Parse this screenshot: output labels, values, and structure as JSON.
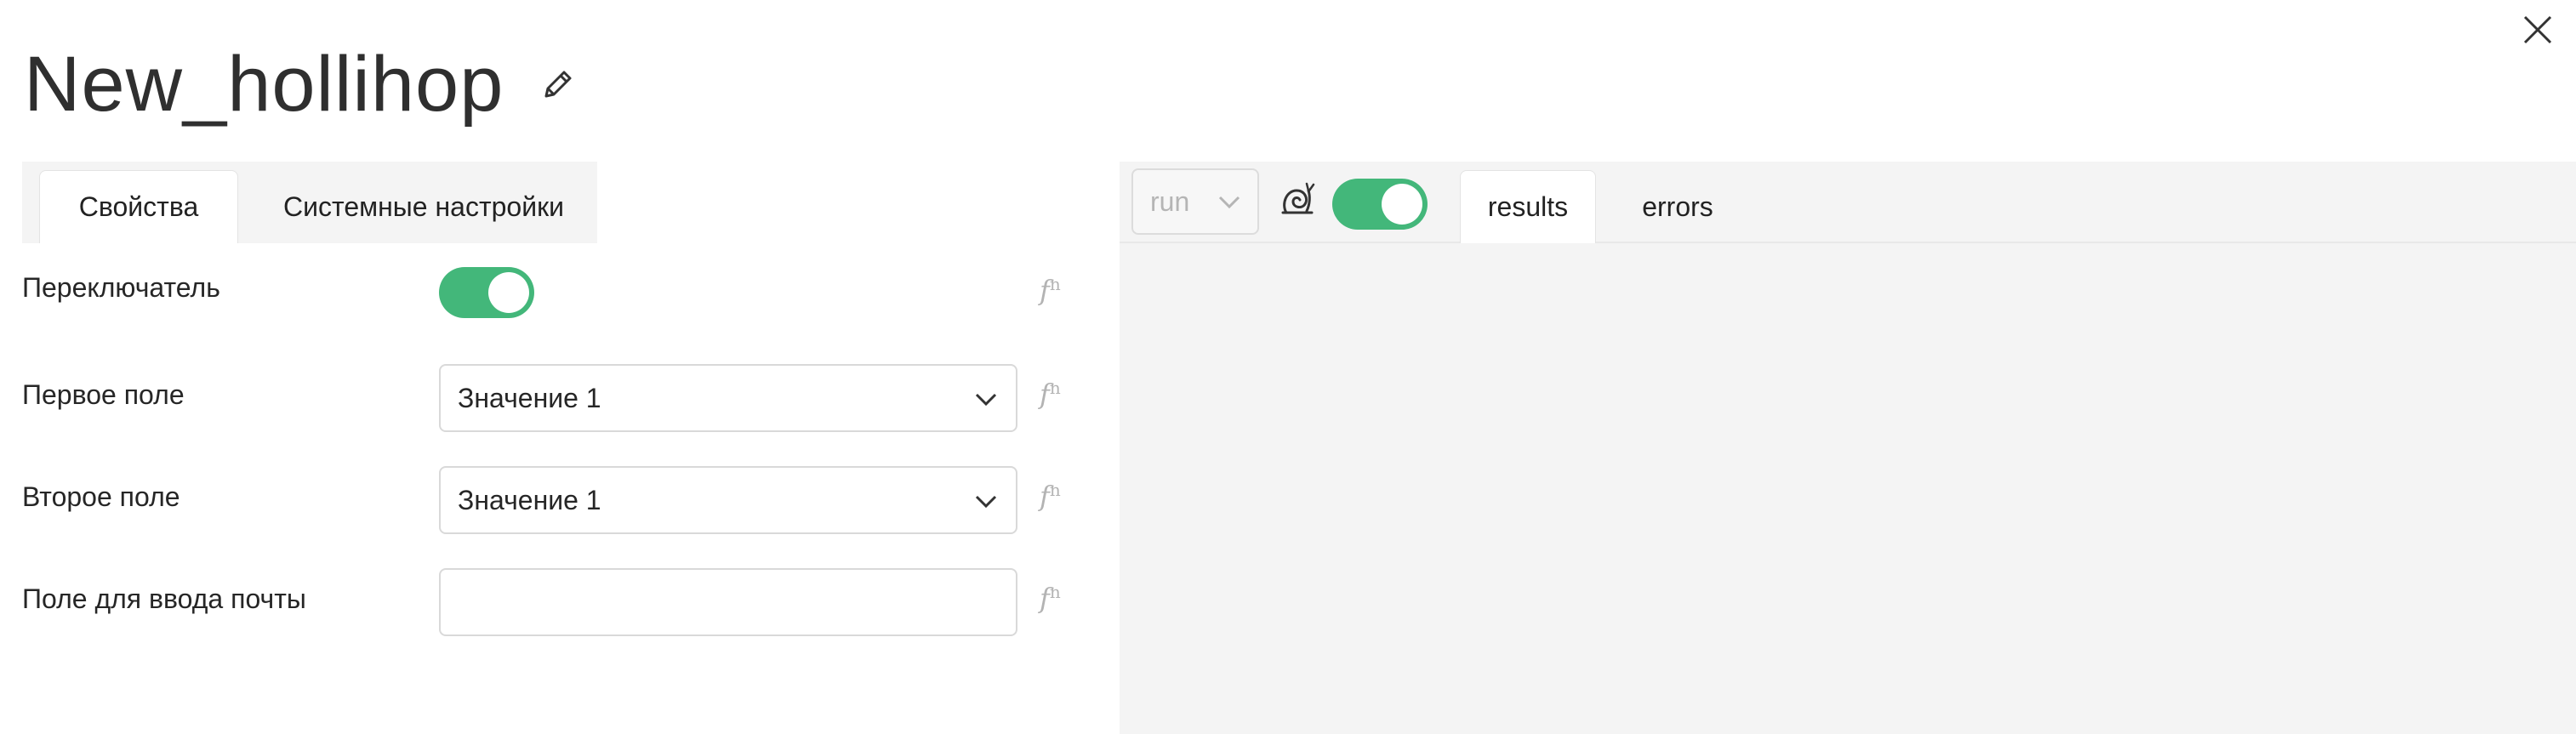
{
  "page": {
    "title": "New_hollihop"
  },
  "icons": {
    "close": "close-icon",
    "edit": "pencil-icon",
    "fn": "function-icon",
    "chevron": "chevron-down-icon",
    "snail": "snail-icon"
  },
  "colors": {
    "accent": "#43b77a",
    "panel_bg": "#f4f4f4",
    "muted": "#b3b3b3"
  },
  "left_tabs": [
    {
      "label": "Свойства",
      "active": true
    },
    {
      "label": "Системные настройки",
      "active": false
    }
  ],
  "fields": {
    "switch": {
      "label": "Переключатель",
      "fn": "f",
      "fn_sup": "n",
      "value": true
    },
    "first": {
      "label": "Первое поле",
      "value": "Значение 1",
      "fn": "f",
      "fn_sup": "n"
    },
    "second": {
      "label": "Второе поле",
      "value": "Значение 1",
      "fn": "f",
      "fn_sup": "n"
    },
    "email": {
      "label": "Поле для ввода почты",
      "value": "",
      "placeholder": "",
      "fn": "f",
      "fn_sup": "n"
    }
  },
  "right_toolbar": {
    "run_select": {
      "value": "run"
    },
    "slow_mode_toggle": true,
    "tabs": [
      {
        "label": "results",
        "active": true
      },
      {
        "label": "errors",
        "active": false
      }
    ]
  }
}
